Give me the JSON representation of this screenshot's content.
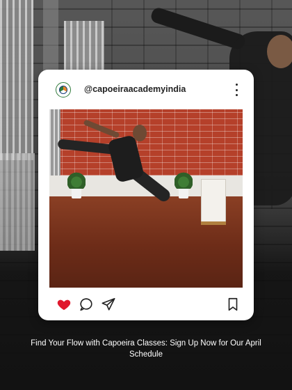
{
  "post": {
    "handle": "@capoeiraacademyindia",
    "avatar_icon": "academy-logo",
    "more_icon": "more-vertical-icon",
    "actions": {
      "like_icon": "heart-filled-icon",
      "comment_icon": "comment-icon",
      "share_icon": "send-icon",
      "save_icon": "bookmark-icon"
    },
    "liked": true
  },
  "caption": "Find Your Flow with Capoeira Classes: Sign Up Now for Our April Schedule",
  "colors": {
    "like": "#e0182d",
    "card_background": "#ffffff",
    "caption_text": "#ffffff",
    "icon": "#222222"
  }
}
